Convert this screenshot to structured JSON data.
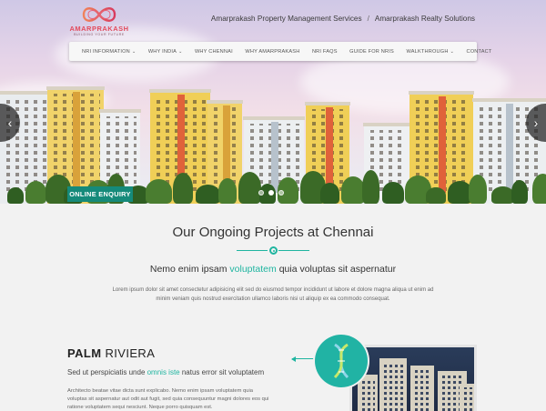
{
  "brand": {
    "name": "AMARPRAKASH",
    "tagline": "BUILDING YOUR FUTURE"
  },
  "top_links": [
    "Amarprakash Property Management Services",
    "Amarprakash Realty Solutions"
  ],
  "nav": [
    {
      "label": "NRI INFORMATION",
      "dropdown": true
    },
    {
      "label": "WHY INDIA",
      "dropdown": true
    },
    {
      "label": "WHY CHENNAI",
      "dropdown": false
    },
    {
      "label": "WHY AMARPRAKASH",
      "dropdown": false
    },
    {
      "label": "NRI FAQS",
      "dropdown": false
    },
    {
      "label": "GUIDE FOR NRIS",
      "dropdown": false
    },
    {
      "label": "WALKTHROUGH",
      "dropdown": true
    },
    {
      "label": "CONTACT",
      "dropdown": false
    }
  ],
  "hero": {
    "enquiry_label": "ONLINE ENQUIRY",
    "slides": 3,
    "active_slide": 1
  },
  "projects": {
    "heading": "Our Ongoing Projects at Chennai",
    "sub_before": "Nemo enim ipsam ",
    "sub_accent": "voluptatem",
    "sub_after": " quia voluptas sit aspernatur",
    "intro": "Lorem ipsum dolor sit amet consectetur adipisicing elit sed do eiusmod tempor incididunt ut labore et dolore magna aliqua ut enim ad minim veniam quis nostrud exercitation ullamco laboris nisi ut aliquip ex ea commodo consequat."
  },
  "project": {
    "name_bold": "PALM",
    "name_rest": " RIVIERA",
    "sub_before": "Sed ut perspiciatis unde ",
    "sub_accent": "omnis iste",
    "sub_after": " natus error sit voluptatem",
    "desc": "Architecto beatae vitae dicta sunt explicabo. Nemo enim ipsam voluptatem quia voluptas sit aspernatur aut odit aut fugit, sed quia consequuntur magni dolores eos qui ratione voluptatem sequi nesciunt. Neque porro quisquam est."
  },
  "colors": {
    "accent": "#1fb5a0",
    "enquiry": "#158a7a",
    "logo": "#e24a5c"
  }
}
